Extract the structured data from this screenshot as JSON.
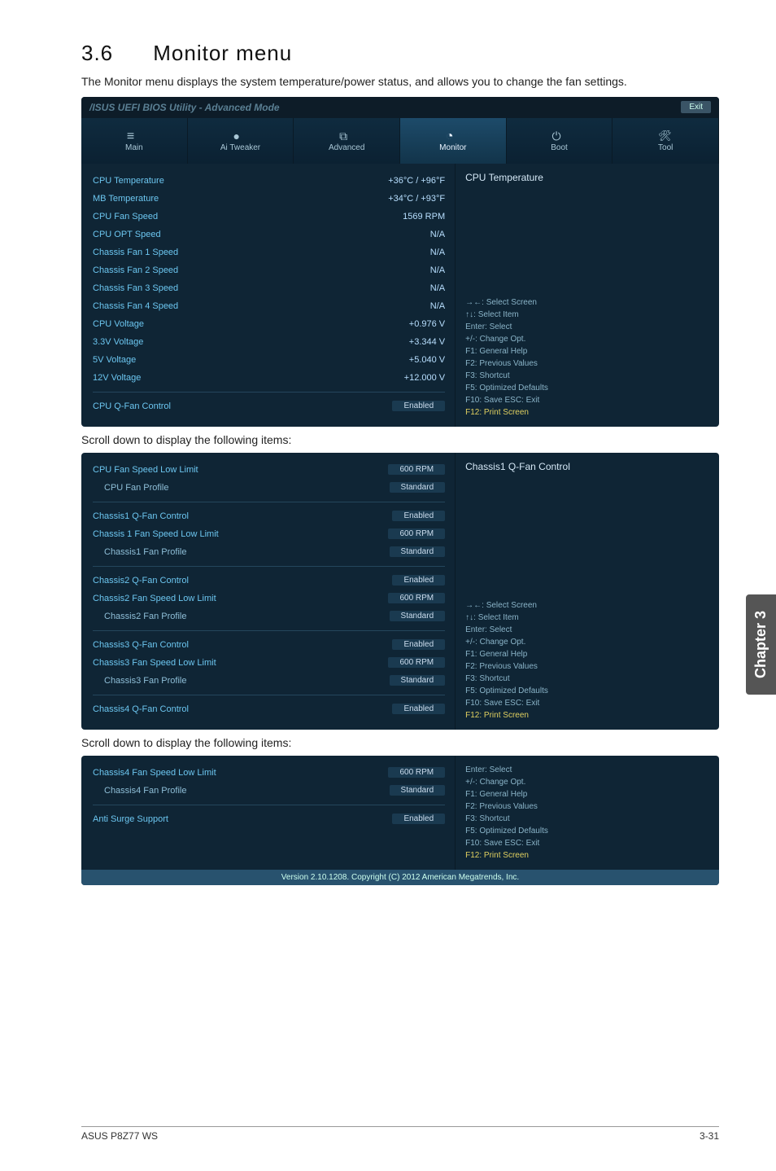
{
  "doc": {
    "section_number": "3.6",
    "section_title": "Monitor menu",
    "intro": "The Monitor menu displays the system temperature/power status, and allows you to change the fan settings.",
    "scroll_note": "Scroll down to display the following items:",
    "chapter_tab": "Chapter 3",
    "footer_left": "ASUS P8Z77 WS",
    "footer_right": "3-31"
  },
  "bios": {
    "titlebar": "/ISUS UEFI BIOS Utility - Advanced Mode",
    "exit_label": "Exit",
    "tabs": [
      {
        "label": "Main"
      },
      {
        "label": "Ai Tweaker"
      },
      {
        "label": "Advanced"
      },
      {
        "label": "Monitor"
      },
      {
        "label": "Boot"
      },
      {
        "label": "Tool"
      }
    ],
    "help_keys": {
      "line1": "→←: Select Screen",
      "line2": "↑↓: Select Item",
      "line3": "Enter: Select",
      "line4": "+/-: Change Opt.",
      "line5": "F1: General Help",
      "line6": "F2: Previous Values",
      "line7": "F3: Shortcut",
      "line8": "F5: Optimized Defaults",
      "line9": "F10: Save  ESC: Exit",
      "line10": "F12: Print Screen"
    },
    "footer": "Version 2.10.1208. Copyright (C) 2012 American Megatrends, Inc."
  },
  "win1": {
    "help_title": "CPU Temperature",
    "rows": [
      {
        "label": "CPU Temperature",
        "value": "+36°C / +96°F"
      },
      {
        "label": "MB Temperature",
        "value": "+34°C / +93°F"
      },
      {
        "label": "CPU Fan Speed",
        "value": "1569 RPM"
      },
      {
        "label": "CPU OPT Speed",
        "value": "N/A"
      },
      {
        "label": "Chassis Fan 1 Speed",
        "value": "N/A"
      },
      {
        "label": "Chassis Fan 2 Speed",
        "value": "N/A"
      },
      {
        "label": "Chassis Fan 3 Speed",
        "value": "N/A"
      },
      {
        "label": "Chassis Fan 4 Speed",
        "value": "N/A"
      },
      {
        "label": "CPU Voltage",
        "value": "+0.976 V"
      },
      {
        "label": "3.3V Voltage",
        "value": "+3.344 V"
      },
      {
        "label": "5V Voltage",
        "value": "+5.040 V"
      },
      {
        "label": "12V Voltage",
        "value": "+12.000 V"
      }
    ],
    "qfan": {
      "label": "CPU Q-Fan Control",
      "value": "Enabled"
    }
  },
  "win2": {
    "help_title": "Chassis1 Q-Fan Control",
    "groups": [
      {
        "rows": [
          {
            "label": "CPU Fan Speed Low Limit",
            "value": "600 RPM",
            "btn": true
          },
          {
            "label": "CPU Fan Profile",
            "value": "Standard",
            "btn": true,
            "indent": true
          }
        ]
      },
      {
        "rows": [
          {
            "label": "Chassis1 Q-Fan Control",
            "value": "Enabled",
            "btn": true
          },
          {
            "label": "Chassis 1 Fan Speed Low Limit",
            "value": "600 RPM",
            "btn": true
          },
          {
            "label": "Chassis1 Fan Profile",
            "value": "Standard",
            "btn": true,
            "indent": true
          }
        ]
      },
      {
        "rows": [
          {
            "label": "Chassis2 Q-Fan Control",
            "value": "Enabled",
            "btn": true
          },
          {
            "label": "Chassis2 Fan Speed Low Limit",
            "value": "600 RPM",
            "btn": true
          },
          {
            "label": "Chassis2 Fan Profile",
            "value": "Standard",
            "btn": true,
            "indent": true
          }
        ]
      },
      {
        "rows": [
          {
            "label": "Chassis3 Q-Fan Control",
            "value": "Enabled",
            "btn": true
          },
          {
            "label": "Chassis3 Fan Speed Low Limit",
            "value": "600 RPM",
            "btn": true
          },
          {
            "label": "Chassis3 Fan Profile",
            "value": "Standard",
            "btn": true,
            "indent": true
          }
        ]
      }
    ],
    "last": {
      "label": "Chassis4 Q-Fan Control",
      "value": "Enabled",
      "btn": true
    }
  },
  "win3": {
    "rows": [
      {
        "label": "Chassis4 Fan Speed Low Limit",
        "value": "600 RPM",
        "btn": true
      },
      {
        "label": "Chassis4 Fan Profile",
        "value": "Standard",
        "btn": true,
        "indent": true
      }
    ],
    "last": {
      "label": "Anti Surge Support",
      "value": "Enabled",
      "btn": true
    }
  }
}
